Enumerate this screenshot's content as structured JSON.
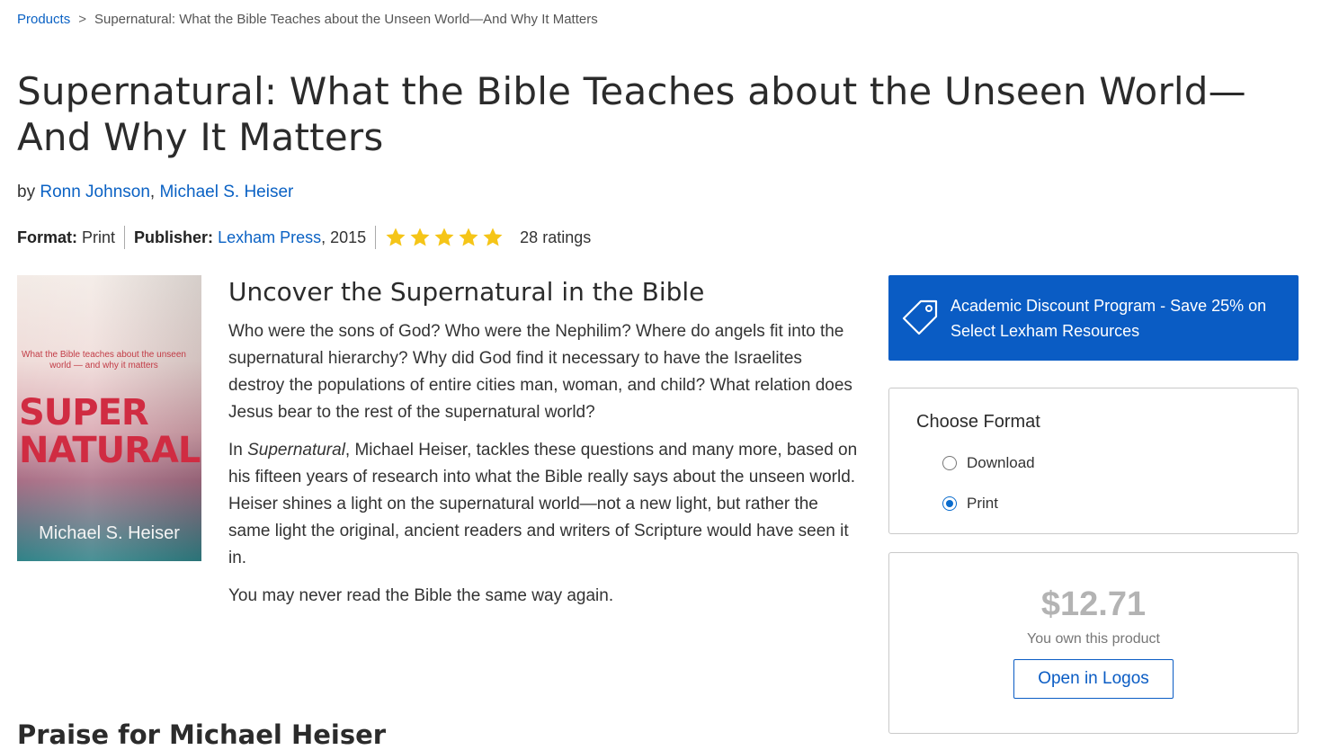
{
  "breadcrumb": {
    "root": "Products",
    "separator": ">",
    "current": "Supernatural: What the Bible Teaches about the Unseen World—And Why It Matters"
  },
  "product": {
    "title": "Supernatural: What the Bible Teaches about the Unseen World—And Why It Matters",
    "by_label": "by",
    "authors": [
      "Ronn Johnson",
      "Michael S. Heiser"
    ],
    "author_separator": ",",
    "format_label": "Format:",
    "format_value": "Print",
    "publisher_label": "Publisher:",
    "publisher_name": "Lexham Press",
    "publisher_year": ", 2015",
    "rating_stars": 5,
    "ratings_count": "28 ratings"
  },
  "cover": {
    "tagline": "What the Bible teaches about the unseen world — and why it matters",
    "title_line1": "SUPER",
    "title_line2": "NATURAL",
    "author": "Michael S. Heiser"
  },
  "description": {
    "heading": "Uncover the Supernatural in the Bible",
    "para1": "Who were the sons of God? Who were the Nephilim? Where do angels fit into the supernatural hierarchy? Why did God find it necessary to have the Israelites destroy the populations of entire cities man, woman, and child? What relation does Jesus bear to the rest of the supernatural world?",
    "para2_prefix": "In ",
    "para2_italic": "Supernatural",
    "para2_rest": ", Michael Heiser, tackles these questions and many more, based on his fifteen years of research into what the Bible really says about the unseen world. Heiser shines a light on the supernatural world—not a new light, but rather the same light the original, ancient readers and writers of Scripture would have seen it in.",
    "para3": "You may never read the Bible the same way again."
  },
  "praise": {
    "heading": "Praise for Michael Heiser"
  },
  "promo": {
    "text": "Academic Discount Program - Save 25% on Select Lexham Resources",
    "icon": "price-tag-icon",
    "color": "#0a5cc4"
  },
  "format_selector": {
    "title": "Choose Format",
    "options": [
      {
        "label": "Download",
        "selected": false
      },
      {
        "label": "Print",
        "selected": true
      }
    ]
  },
  "purchase": {
    "price": "$12.71",
    "owned_text": "You own this product",
    "open_button": "Open in Logos"
  },
  "colors": {
    "link": "#0b62c4",
    "star": "#f5c518",
    "accent": "#0a5cc4"
  }
}
